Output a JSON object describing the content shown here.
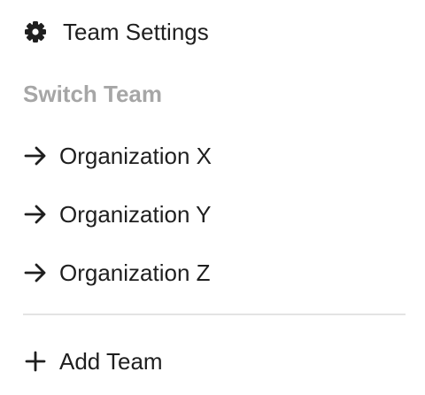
{
  "menu": {
    "settings": {
      "label": "Team Settings",
      "icon": "gear-icon"
    },
    "switch_heading": "Switch Team",
    "teams": [
      {
        "label": "Organization X",
        "icon": "arrow-right-icon"
      },
      {
        "label": "Organization Y",
        "icon": "arrow-right-icon"
      },
      {
        "label": "Organization Z",
        "icon": "arrow-right-icon"
      }
    ],
    "add_team": {
      "label": "Add Team",
      "icon": "plus-icon"
    }
  },
  "colors": {
    "text": "#1f1f1f",
    "heading_muted": "#a6a6a6",
    "divider": "#e3e3e3",
    "background": "#ffffff"
  }
}
